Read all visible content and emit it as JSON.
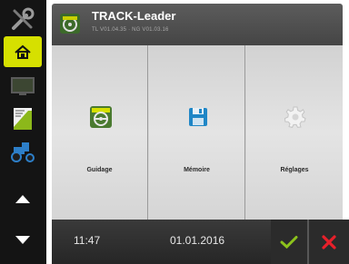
{
  "header": {
    "title": "TRACK-Leader",
    "version": "TL V01.04.35 · NG V01.03.16",
    "logo_icon": "track-leader-logo-icon"
  },
  "sidebar": {
    "items": [
      {
        "icon": "wrench-screwdriver-icon",
        "active": false
      },
      {
        "icon": "terminal-home-icon",
        "active": true
      },
      {
        "icon": "monitor-icon",
        "active": false
      },
      {
        "icon": "field-map-icon",
        "active": false
      },
      {
        "icon": "tractor-icon",
        "active": false
      },
      {
        "icon": "arrow-up-icon",
        "active": false
      },
      {
        "icon": "arrow-down-icon",
        "active": false
      }
    ]
  },
  "tiles": [
    {
      "label": "Guidage",
      "icon": "guidance-icon"
    },
    {
      "label": "Mémoire",
      "icon": "floppy-disk-icon"
    },
    {
      "label": "Réglages",
      "icon": "gear-icon"
    }
  ],
  "status": {
    "time": "11:47",
    "date": "01.01.2016"
  },
  "colors": {
    "accent_yellow": "#d6e000",
    "ok_green": "#8cc21c",
    "cancel_red": "#e8202a"
  }
}
